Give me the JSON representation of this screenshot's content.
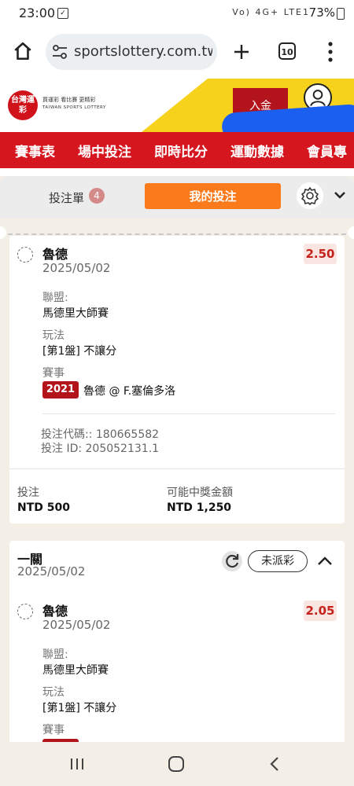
{
  "status_bar": {
    "time": "23:00",
    "network": "Vo) 4G+ LTE1",
    "battery": "73%"
  },
  "browser": {
    "url": "sportslottery.com.tw",
    "tab_count": "10"
  },
  "header": {
    "logo_text": "台灣運彩",
    "logo_tagline": "買運彩 看比賽 更精彩",
    "logo_sub": "TAIWAN SPORTS LOTTERY",
    "deposit_label": "入金"
  },
  "nav": {
    "items": [
      "賽事表",
      "場中投注",
      "即時比分",
      "運動數據",
      "會員專"
    ]
  },
  "panel": {
    "tab_betslip": "投注單",
    "betslip_count": "4",
    "tab_mybets": "我的投注"
  },
  "bets": [
    {
      "selection": "魯德",
      "date": "2025/05/02",
      "odds": "2.50",
      "league_label": "聯盟:",
      "league": "馬德里大師賽",
      "market_label": "玩法",
      "market_prefix": "[第1盤]",
      "market": " 不讓分",
      "event_label": "賽事",
      "event_year": "2021",
      "event": "魯德 @ F.塞倫多洛",
      "code_line": "投注代碼:: 180665582",
      "id_line": "投注 ID: 205052131.1",
      "stake_label": "投注",
      "stake": "NTD 500",
      "payout_label": "可能中獎金額",
      "payout": "NTD 1,250"
    },
    {
      "type_label": "一關",
      "type_date": "2025/05/02",
      "status": "未派彩",
      "selection": "魯德",
      "date": "2025/05/02",
      "odds": "2.05",
      "league_label": "聯盟:",
      "league": "馬德里大師賽",
      "market_label": "玩法",
      "market_prefix": "[第1盤]",
      "market": " 不讓分",
      "event_label": "賽事"
    }
  ],
  "colors": {
    "brand_red": "#d6161f",
    "accent_orange": "#fb7a1c",
    "badge_red": "#b3141c"
  }
}
